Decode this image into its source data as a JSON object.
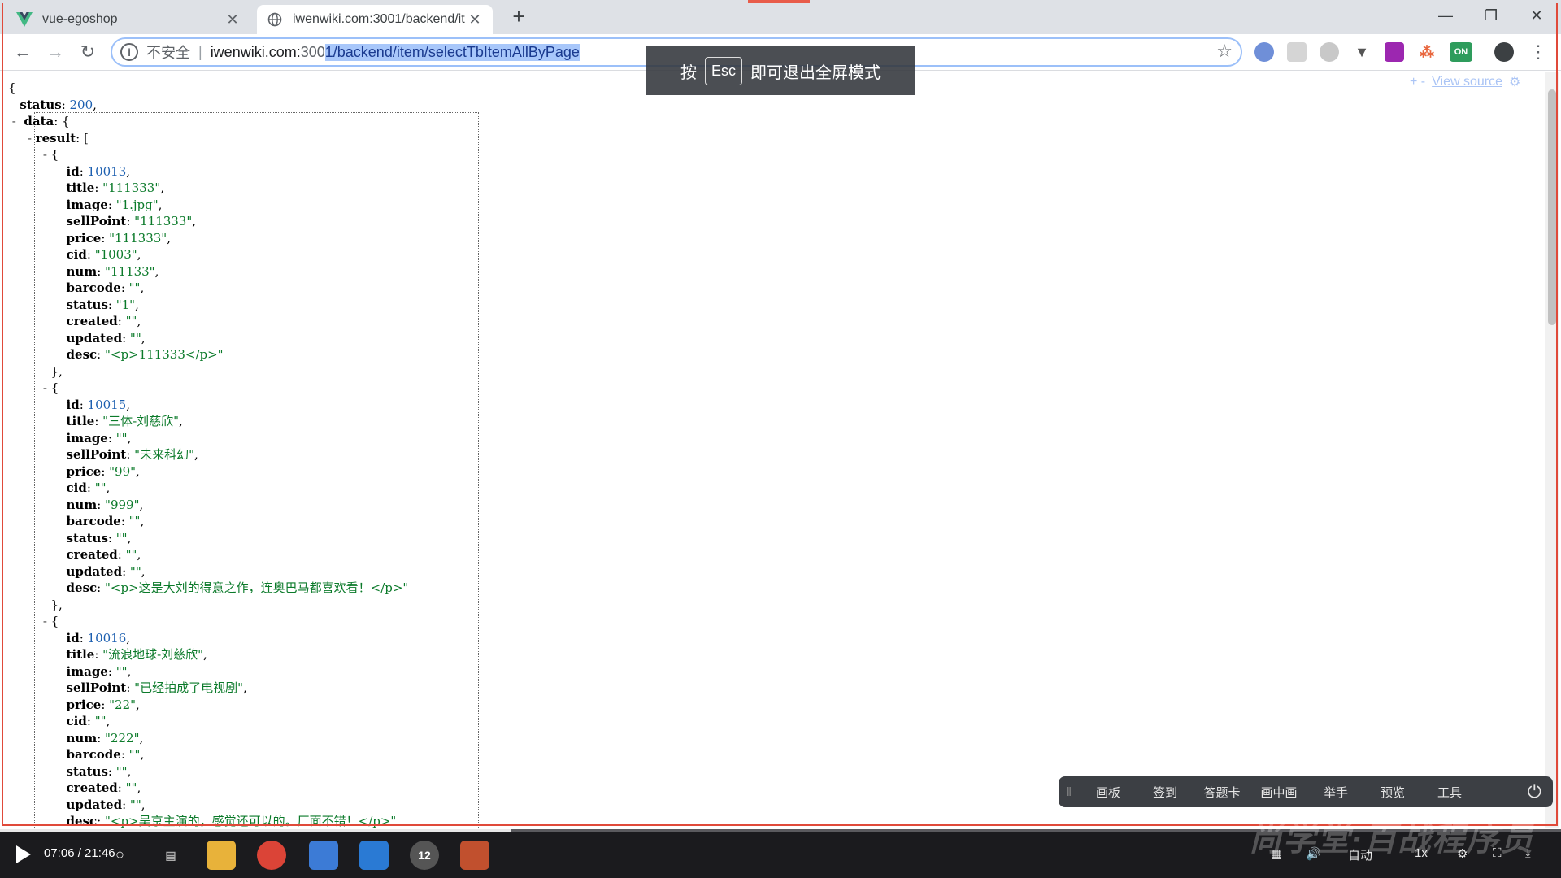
{
  "browser": {
    "tabs": [
      {
        "title": "vue-egoshop",
        "active": false
      },
      {
        "title": "iwenwiki.com:3001/backend/it",
        "active": true
      }
    ],
    "new_tab_label": "+",
    "omnibox": {
      "security_label": "不安全",
      "host": "iwenwiki.com:",
      "port_unselected": "300",
      "selected_part": "1/backend/item/selectTbItemAllByPage"
    },
    "extensions": [
      "ON"
    ]
  },
  "fullscreen_toast": {
    "prefix": "按",
    "key": "Esc",
    "suffix": "即可退出全屏模式"
  },
  "json_viewer": {
    "view_source_controls": "+ -",
    "view_source_label": "View source",
    "status_value": "200",
    "items": [
      {
        "id": "10013",
        "title": "\"111333\"",
        "image": "\"1.jpg\"",
        "sellPoint": "\"111333\"",
        "price": "\"111333\"",
        "cid": "\"1003\"",
        "num": "\"11133\"",
        "barcode": "\"\"",
        "status": "\"1\"",
        "created": "\"\"",
        "updated": "\"\"",
        "desc": "\"<p>111333</p>\""
      },
      {
        "id": "10015",
        "title": "\"三体-刘慈欣\"",
        "image": "\"\"",
        "sellPoint": "\"未来科幻\"",
        "price": "\"99\"",
        "cid": "\"\"",
        "num": "\"999\"",
        "barcode": "\"\"",
        "status": "\"\"",
        "created": "\"\"",
        "updated": "\"\"",
        "desc": "\"<p>这是大刘的得意之作，连奥巴马都喜欢看！</p>\""
      },
      {
        "id": "10016",
        "title": "\"流浪地球-刘慈欣\"",
        "image": "\"\"",
        "sellPoint": "\"已经拍成了电视剧\"",
        "price": "\"22\"",
        "cid": "\"\"",
        "num": "\"222\"",
        "barcode": "\"\"",
        "status": "\"\"",
        "created": "\"\"",
        "updated": "\"\"",
        "desc": "\"<p>吴京主演的，感觉还可以的。厂面不错！</p>\""
      }
    ]
  },
  "class_tools": {
    "items": [
      "画板",
      "签到",
      "答题卡",
      "画中画",
      "举手",
      "预览",
      "工具"
    ]
  },
  "player": {
    "time": "07:06 / 21:46",
    "progress": 0.327,
    "quality": "自动",
    "speed": "1x",
    "taskbar_badge": "12"
  },
  "watermark": "尚学堂·百战程序员"
}
